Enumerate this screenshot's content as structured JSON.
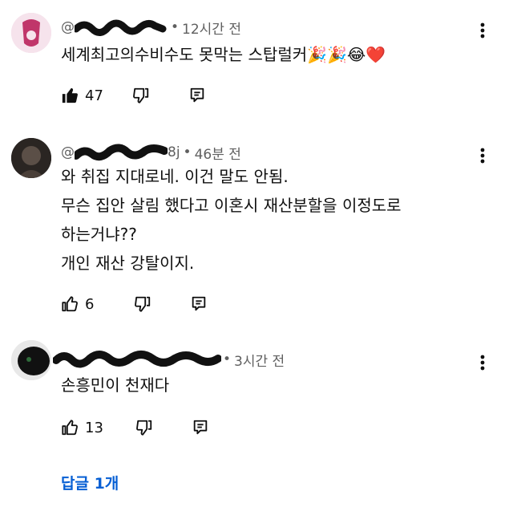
{
  "comments": [
    {
      "handle_visible": "@",
      "time": "12시간 전",
      "text_lines": [
        "세계최고의수비수도 못막는 스탑럴커🎉🎉😂❤️"
      ],
      "likes": "47",
      "liked": true
    },
    {
      "handle_visible": "@",
      "handle_suffix": "8j",
      "time": "46분 전",
      "text_lines": [
        "와 취집 지대로네. 이건 말도 안됨.",
        "무슨 집안 살림 했다고 이혼시 재산분할을 이정도로",
        "하는거냐??",
        "개인 재산 강탈이지."
      ],
      "likes": "6",
      "liked": false
    },
    {
      "handle_visible": "",
      "time": "3시간 전",
      "text_lines": [
        "손흥민이 천재다"
      ],
      "likes": "13",
      "liked": false
    }
  ],
  "reply_link": "답글 1개",
  "icons": {
    "like": "thumbs-up-icon",
    "dislike": "thumbs-down-icon",
    "reply": "reply-icon",
    "menu": "more-vert-icon"
  },
  "colors": {
    "link": "#065fd4",
    "meta": "#606060",
    "text": "#0f0f0f"
  }
}
